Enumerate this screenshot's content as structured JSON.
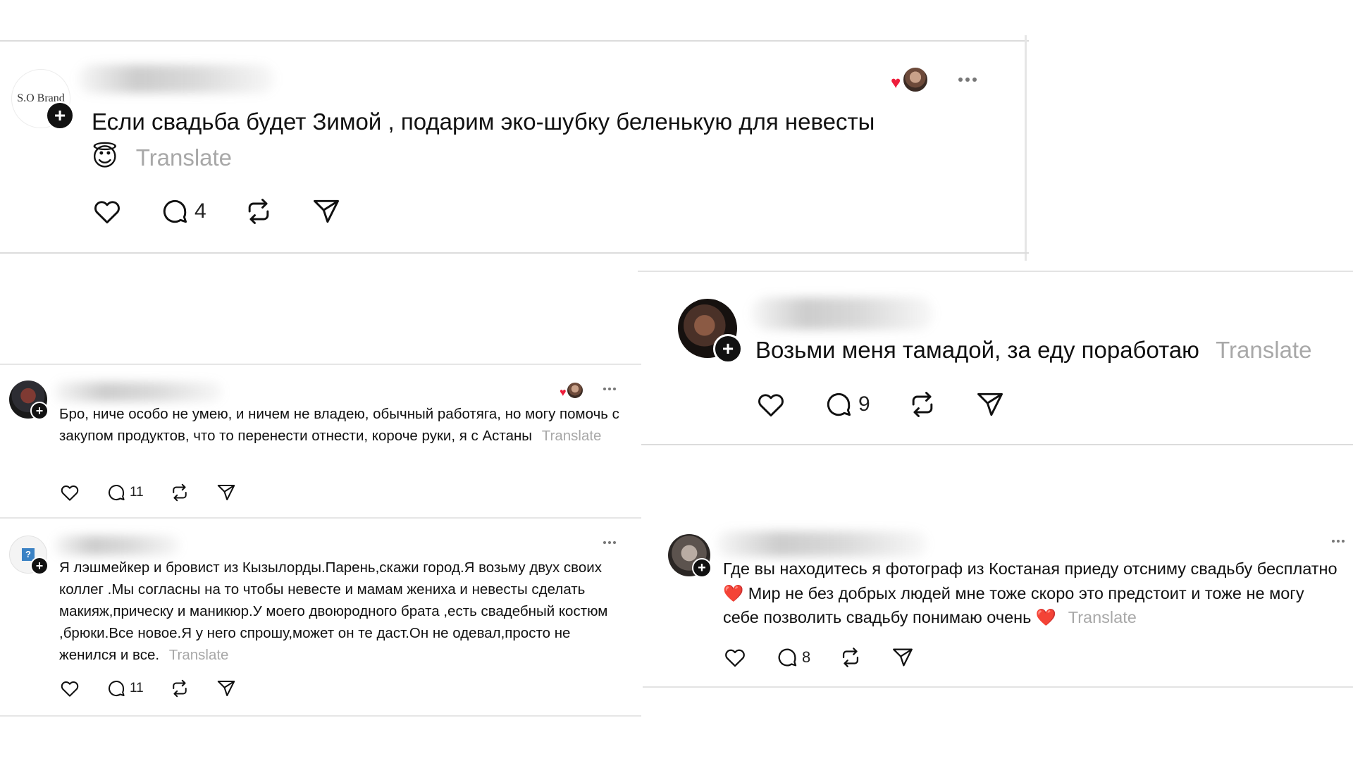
{
  "posts": [
    {
      "id": "post1",
      "avatar_text": "S.O Brand",
      "text": "Если свадьба будет Зимой , подарим эко-шубку беленькую для невесты",
      "emoji": "😇",
      "translate_label": "Translate",
      "comments": "4"
    },
    {
      "id": "post2",
      "text": "Возьми меня тамадой, за еду поработаю",
      "translate_label": "Translate",
      "comments": "9"
    },
    {
      "id": "post3",
      "text": "Бро, ниче особо не умею, и ничем не владею, обычный работяга, но могу помочь с закупом продуктов, что то перенести отнести, короче руки, я с Астаны",
      "translate_label": "Translate",
      "comments": "11"
    },
    {
      "id": "post4",
      "text": "Я лэшмейкер и бровист из Кызылорды.Парень,скажи город.Я возьму двух своих коллег .Мы согласны на то чтобы невесте и мамам жениха и невесты сделать макияж,прическу и маникюр.У моего двоюродного брата ,есть свадебный костюм ,брюки.Все новое.Я у него спрошу,может он те даст.Он не одевал,просто не женился и все.",
      "translate_label": "Translate",
      "comments": "11"
    },
    {
      "id": "post5",
      "text_part1": "Где вы находитесь я фотограф из Костаная приеду отсниму свадьбу бесплатно",
      "text_part2": "Мир не без добрых людей мне тоже скоро это предстоит и тоже не могу себе позволить свадьбу понимаю очень",
      "heart_emoji": "❤️",
      "translate_label": "Translate",
      "comments": "8"
    }
  ],
  "icons": {
    "like": "heart-outline-icon",
    "comment": "comment-bubble-icon",
    "repost": "repost-icon",
    "share": "send-icon",
    "more": "more-dots-icon",
    "follow": "plus-icon"
  },
  "colors": {
    "text": "#111111",
    "translate": "#a8a8a8",
    "heart": "#ee1d3b",
    "divider": "#dcdcdc"
  }
}
